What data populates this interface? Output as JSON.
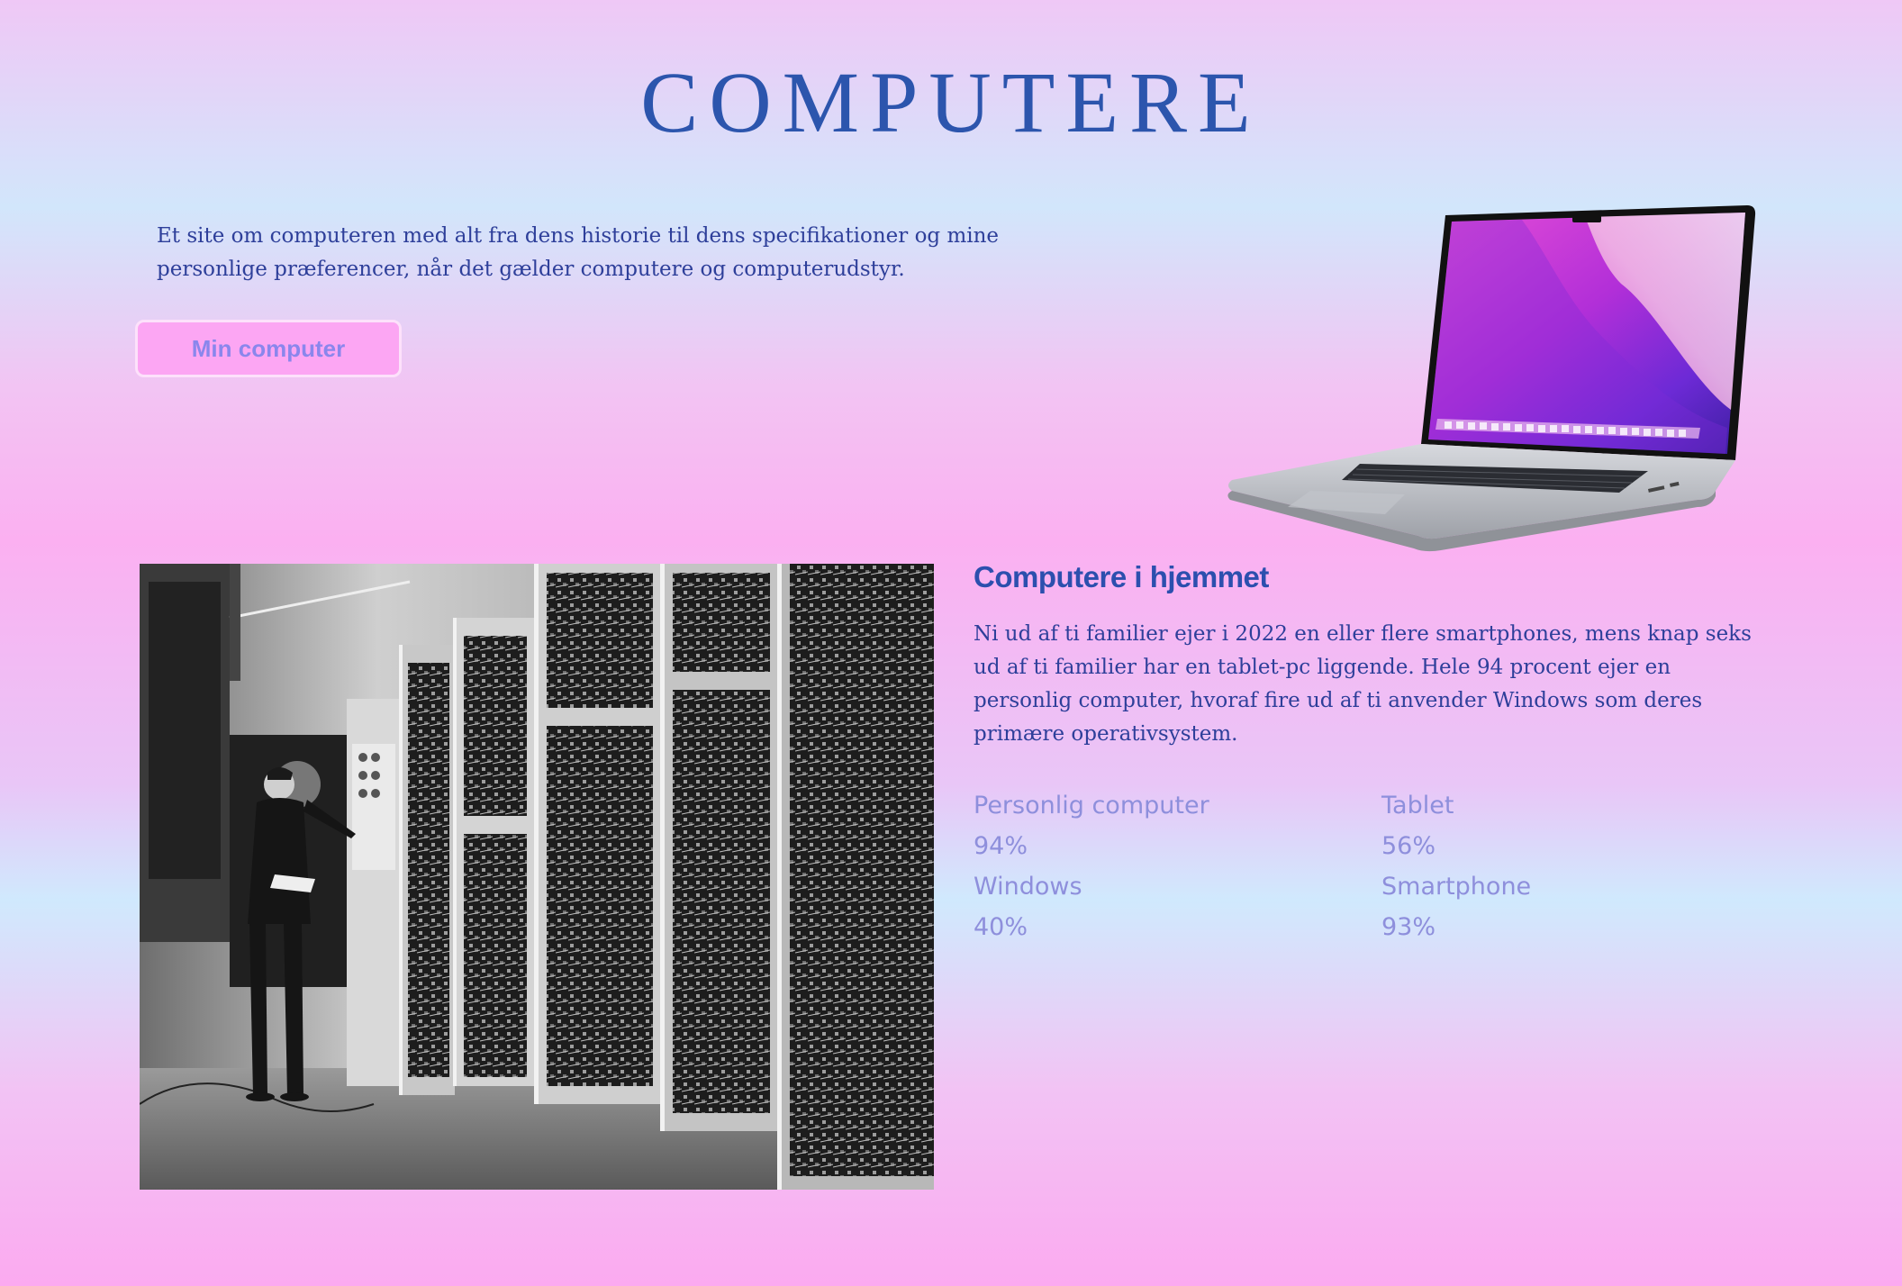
{
  "page": {
    "title": "COMPUTERE",
    "intro": "Et site om computeren med alt fra dens historie til dens specifikationer og mine personlige præferencer, når det gælder computere og computerudstyr.",
    "cta_label": "Min computer"
  },
  "section": {
    "heading": "Computere i hjemmet",
    "body": "Ni ud af ti familier ejer i 2022 en eller flere smartphones, mens knap seks ud af ti familier har en tablet-pc liggende. Hele 94 procent ejer en personlig computer, hvoraf fire ud af ti anvender Windows som deres primære operativsystem."
  },
  "stats": [
    {
      "label": "Personlig computer",
      "value": "94%"
    },
    {
      "label": "Tablet",
      "value": "56%"
    },
    {
      "label": "Windows",
      "value": "40%"
    },
    {
      "label": "Smartphone",
      "value": "93%"
    }
  ],
  "images": {
    "laptop": "laptop-image",
    "mainframe": "mainframe-photo"
  },
  "colors": {
    "title": "#2c55ad",
    "text": "#2e3f9a",
    "button_bg": "#fca6f3",
    "button_text": "#8a86ec",
    "stat_text": "#8e8fdc"
  }
}
